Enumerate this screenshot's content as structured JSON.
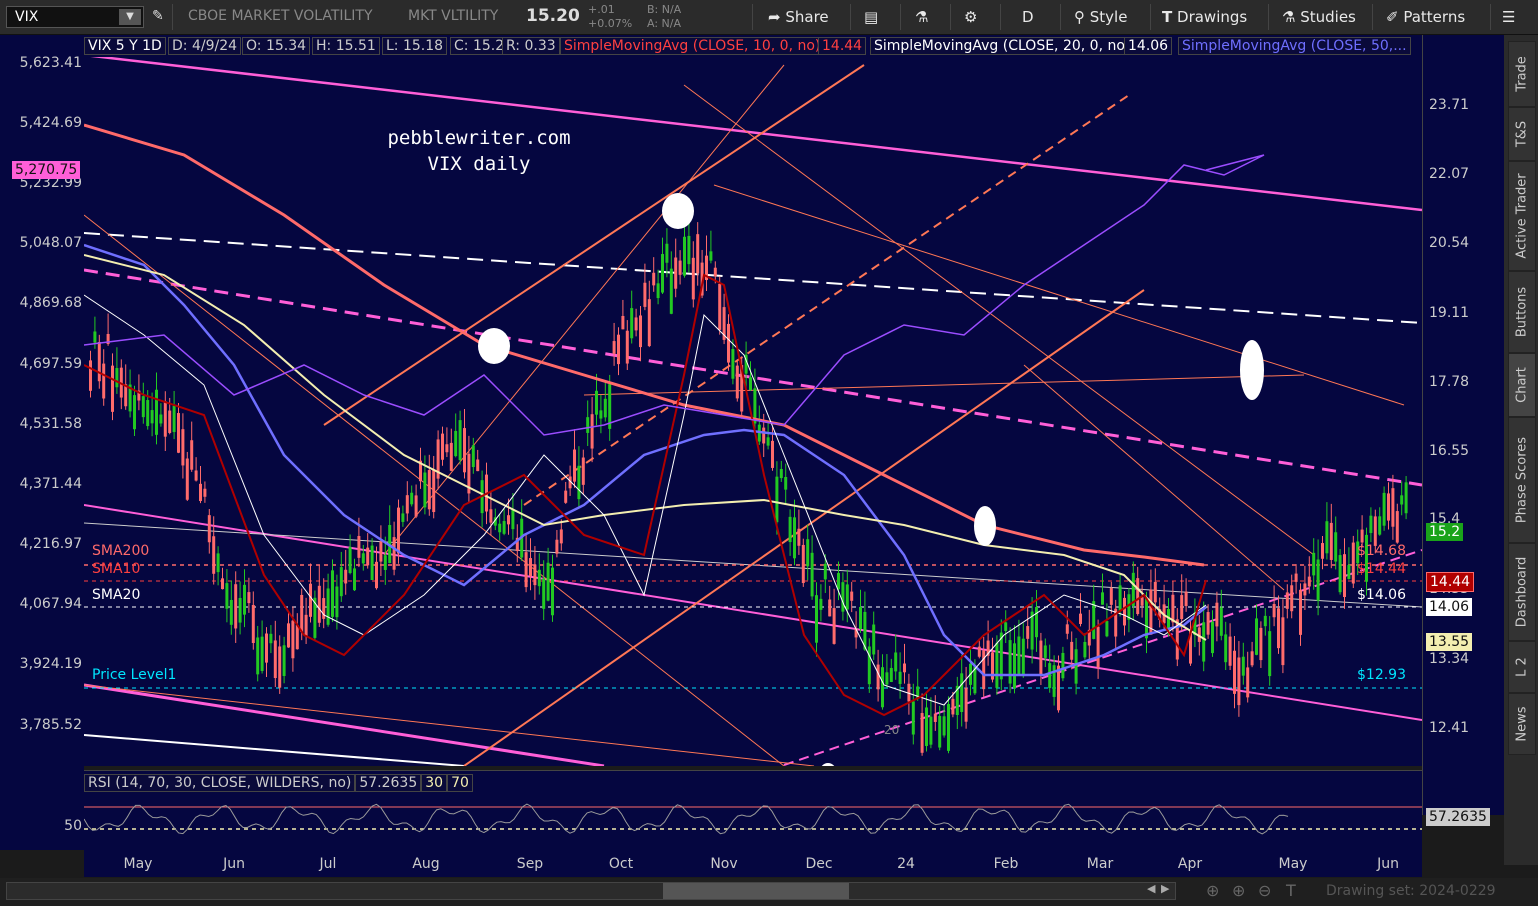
{
  "toolbar": {
    "symbol": "VIX",
    "description": "CBOE MARKET VOLATILITY",
    "short_desc": "MKT VLTILITY",
    "price": "15.20",
    "change": "+.01",
    "change_pct": "+0.07%",
    "bid": "B: N/A",
    "ask": "A: N/A",
    "share_label": "Share",
    "period_label": "D",
    "style_label": "Style",
    "drawings_label": "Drawings",
    "studies_label": "Studies",
    "patterns_label": "Patterns"
  },
  "header": {
    "title": "VIX 5 Y 1D",
    "date": "D: 4/9/24",
    "open": "O: 15.34",
    "high": "H: 15.51",
    "low": "L: 15.18",
    "close": "C: 15.2",
    "range": "R: 0.33",
    "sma10_label": "SimpleMovingAvg (CLOSE, 10, 0, no)",
    "sma10_value": "14.44",
    "sma20_label": "SimpleMovingAvg (CLOSE, 20, 0, no)",
    "sma20_value": "14.06",
    "sma50_label": "SimpleMovingAvg (CLOSE, 50,..."
  },
  "watermark": {
    "line1": "pebblewriter.com",
    "line2": "VIX daily"
  },
  "left_axis": [
    "5,623.41",
    "5,424.69",
    "5,232.99",
    "5,048.07",
    "4,869.68",
    "4,697.59",
    "4,531.58",
    "4,371.44",
    "4,216.97",
    "4,067.94",
    "3,924.19",
    "3,785.52"
  ],
  "left_tag": "5,270.75",
  "right_axis": [
    "23.71",
    "22.07",
    "20.54",
    "19.11",
    "17.78",
    "16.55",
    "15.4",
    "14.53",
    "13.34",
    "12.41"
  ],
  "right_tags": {
    "last": "15.2",
    "sma10": "14.44",
    "sma20": "14.06",
    "sma50": "13.55"
  },
  "levels": [
    {
      "label": "SMA200",
      "value": "$14.68",
      "color": "#ff6a6a"
    },
    {
      "label": "SMA10",
      "value": "$14.44",
      "color": "#ff4040"
    },
    {
      "label": "SMA20",
      "value": "$14.06",
      "color": "#ffffff"
    },
    {
      "label": "Price Level1",
      "value": "$12.93",
      "color": "#00e5ff"
    }
  ],
  "rsi": {
    "label": "RSI (14, 70, 30, CLOSE, WILDERS, no)",
    "value": "57.2635",
    "lo": "30",
    "hi": "70",
    "axis_label": "50"
  },
  "x_axis": [
    "May",
    "Jun",
    "Jul",
    "Aug",
    "Sep",
    "Oct",
    "Nov",
    "Dec",
    "24",
    "Feb",
    "Mar",
    "Apr",
    "May",
    "Jun"
  ],
  "x_inline_label": "20",
  "sidebar": [
    "Trade",
    "T&S",
    "Active Trader",
    "Buttons",
    "Chart",
    "Phase Scores",
    "Dashboard",
    "L 2",
    "News"
  ],
  "bottom": {
    "drawing_set": "Drawing set: 2024-0229"
  },
  "colors": {
    "bg": "#050640",
    "up": "#22c922",
    "down": "#ff6b6b",
    "sma200": "#ff6a6a",
    "sma50": "#6f6fff",
    "sma20": "#ffffff",
    "sma10": "#b00000",
    "spx": "#9b4dff",
    "magenta": "#ff5fd8"
  }
}
